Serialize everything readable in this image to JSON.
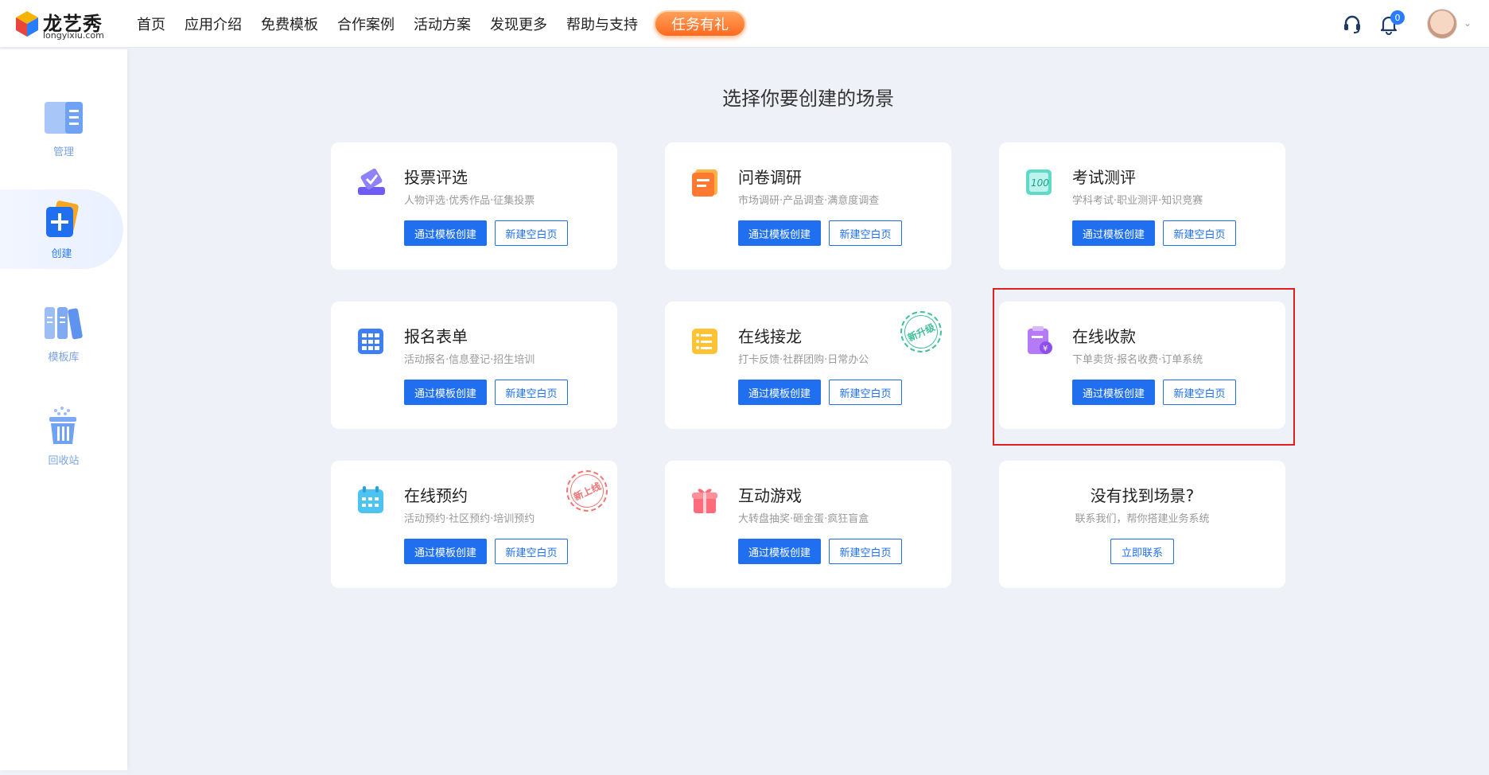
{
  "header": {
    "logo": {
      "cn": "龙艺秀",
      "en": "longyixiu.com"
    },
    "nav": [
      "首页",
      "应用介绍",
      "免费模板",
      "合作案例",
      "活动方案",
      "发现更多",
      "帮助与支持"
    ],
    "promo": "任务有礼",
    "notification_count": "0"
  },
  "sidebar": {
    "items": [
      {
        "label": "管理",
        "icon": "manage-icon",
        "active": false
      },
      {
        "label": "创建",
        "icon": "create-icon",
        "active": true
      },
      {
        "label": "模板库",
        "icon": "template-library-icon",
        "active": false
      },
      {
        "label": "回收站",
        "icon": "recycle-bin-icon",
        "active": false
      }
    ]
  },
  "main": {
    "title": "选择你要创建的场景",
    "template_btn": "通过模板创建",
    "blank_btn": "新建空白页",
    "cards": [
      {
        "title": "投票评选",
        "desc": "人物评选·优秀作品·征集投票",
        "icon": "vote-icon"
      },
      {
        "title": "问卷调研",
        "desc": "市场调研·产品调查·满意度调查",
        "icon": "survey-icon"
      },
      {
        "title": "考试测评",
        "desc": "学科考试·职业测评·知识竞赛",
        "icon": "exam-icon"
      },
      {
        "title": "报名表单",
        "desc": "活动报名·信息登记·招生培训",
        "icon": "form-icon"
      },
      {
        "title": "在线接龙",
        "desc": "打卡反馈·社群团购·日常办公",
        "icon": "solitaire-icon",
        "stamp": "新升级"
      },
      {
        "title": "在线收款",
        "desc": "下单卖货·报名收费·订单系统",
        "icon": "payment-icon"
      },
      {
        "title": "在线预约",
        "desc": "活动预约·社区预约·培训预约",
        "icon": "booking-icon",
        "stamp": "新上线"
      },
      {
        "title": "互动游戏",
        "desc": "大转盘抽奖·砸金蛋·疯狂盲盒",
        "icon": "game-icon"
      }
    ],
    "not_found": {
      "title": "没有找到场景?",
      "desc": "联系我们，帮你搭建业务系统",
      "button": "立即联系"
    }
  },
  "colors": {
    "primary": "#1f6fee",
    "promo": "#ff6a1f",
    "highlight": "#e02020",
    "background": "#eef1f8"
  }
}
